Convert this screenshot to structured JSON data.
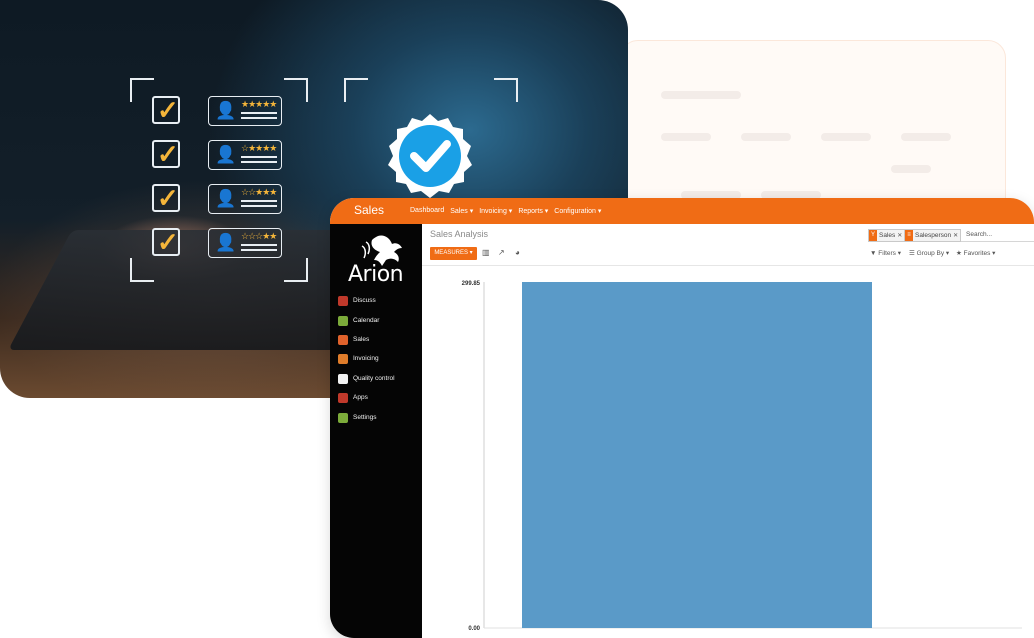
{
  "colors": {
    "accent": "#f06c15",
    "sidebar_bg": "#050505",
    "bar": "#5a9ac8",
    "check": "#f4b53a",
    "badge": "#1aa0e6"
  },
  "illustration": {
    "rows": [
      {
        "stars": "★★★★★"
      },
      {
        "stars": "☆★★★★"
      },
      {
        "stars": "☆☆★★★"
      },
      {
        "stars": "☆☆☆★★"
      }
    ],
    "icons": {
      "check": "check-mark-icon",
      "person": "person-icon",
      "badge": "verified-badge-icon"
    }
  },
  "app": {
    "title": "Sales",
    "nav": [
      "Dashboard",
      "Sales ▾",
      "Invoicing ▾",
      "Reports ▾",
      "Configuration ▾"
    ],
    "logo_text": "Arion",
    "menu": [
      {
        "label": "Discuss",
        "icon": "discuss-icon",
        "color": "#c0392b"
      },
      {
        "label": "Calendar",
        "icon": "calendar-icon",
        "color": "#7cab3a"
      },
      {
        "label": "Sales",
        "icon": "sales-icon",
        "color": "#e0622b"
      },
      {
        "label": "Invoicing",
        "icon": "invoicing-icon",
        "color": "#e07d2b"
      },
      {
        "label": "Quality control",
        "icon": "quality-control-icon",
        "color": "#f2f2f2"
      },
      {
        "label": "Apps",
        "icon": "apps-icon",
        "color": "#c0392b"
      },
      {
        "label": "Settings",
        "icon": "settings-icon",
        "color": "#7cab3a"
      }
    ],
    "page_title": "Sales Analysis",
    "search": {
      "facets": [
        {
          "label": "Sales",
          "icon": "filter-icon",
          "glyph": "Y"
        },
        {
          "label": "Salesperson",
          "icon": "group-icon",
          "glyph": "≡"
        }
      ],
      "placeholder": "Search..."
    },
    "toolbar": {
      "measures_label": "MEASURES ▾",
      "filters_label": "▼ Filters ▾",
      "group_by_label": "☰ Group By ▾",
      "favorites_label": "★ Favorites ▾"
    }
  },
  "chart_data": {
    "type": "bar",
    "categories": [
      ""
    ],
    "values": [
      299.85
    ],
    "ylim": [
      0,
      299.85
    ],
    "y_ticks": [
      "0.00",
      "299.85"
    ],
    "xlabel": "",
    "ylabel": "",
    "title": "",
    "grid": false,
    "legend": "none"
  }
}
